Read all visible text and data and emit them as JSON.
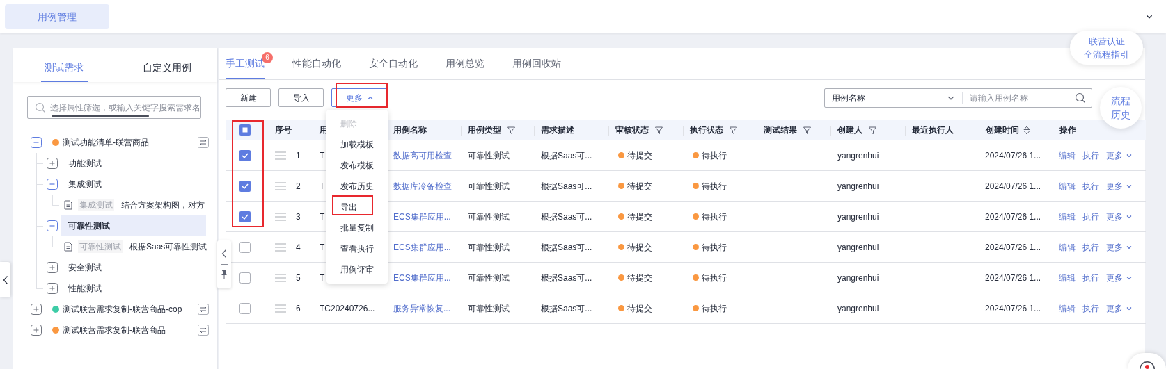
{
  "top_bar": {
    "tabs": [
      {
        "label": "用例管理",
        "selected": true
      }
    ]
  },
  "side_panel": {
    "tabs": [
      {
        "label": "测试需求",
        "selected": true
      },
      {
        "label": "自定义用例",
        "selected": false
      }
    ],
    "search": {
      "placeholder": "选择属性筛选，或输入关键字搜索需求名"
    },
    "tree": [
      {
        "kind": "group",
        "label": "测试功能清单-联营商品",
        "color": "#fa9841",
        "expanded": true,
        "selected": false,
        "children": [
          {
            "kind": "folder",
            "label": "功能测试",
            "expanded": false,
            "selected": false
          },
          {
            "kind": "folder",
            "label": "集成测试",
            "expanded": true,
            "selected": false,
            "children": [
              {
                "kind": "case",
                "tag": "集成测试",
                "label": "结合方案架构图，对方",
                "selected": false
              }
            ]
          },
          {
            "kind": "folder",
            "label": "可靠性测试",
            "expanded": true,
            "selected": true,
            "children": [
              {
                "kind": "case",
                "tag": "可靠性测试",
                "label": "根据Saas可靠性测试",
                "selected": false
              }
            ]
          },
          {
            "kind": "folder",
            "label": "安全测试",
            "expanded": false,
            "selected": false
          },
          {
            "kind": "folder",
            "label": "性能测试",
            "expanded": false,
            "selected": false
          }
        ]
      },
      {
        "kind": "group",
        "label": "测试联营需求复制-联营商品-cop",
        "color": "#3dcca6",
        "expanded": false,
        "selected": false
      },
      {
        "kind": "group",
        "label": "测试联营需求复制-联营商品",
        "color": "#fa9841",
        "expanded": false,
        "selected": false
      }
    ]
  },
  "main": {
    "tabs": [
      {
        "label": "手工测试",
        "selected": true,
        "badge": "6"
      },
      {
        "label": "性能自动化",
        "selected": false
      },
      {
        "label": "安全自动化",
        "selected": false
      },
      {
        "label": "用例总览",
        "selected": false
      },
      {
        "label": "用例回收站",
        "selected": false
      }
    ],
    "toolbar": [
      {
        "kind": "button",
        "label": "新建",
        "highlighted": false
      },
      {
        "kind": "button",
        "label": "导入",
        "highlighted": false
      },
      {
        "kind": "dropdown",
        "label": "更多",
        "expanded": true,
        "highlighted": true
      }
    ],
    "menu": [
      {
        "label": "删除",
        "disabled": true,
        "highlighted": false
      },
      {
        "label": "加载模板",
        "disabled": false,
        "highlighted": false
      },
      {
        "label": "发布模板",
        "disabled": false,
        "highlighted": false
      },
      {
        "label": "发布历史",
        "disabled": false,
        "highlighted": false
      },
      {
        "label": "导出",
        "disabled": false,
        "highlighted": true
      },
      {
        "label": "批量复制",
        "disabled": false,
        "highlighted": false
      },
      {
        "label": "查看执行",
        "disabled": false,
        "highlighted": false
      },
      {
        "label": "用例评审",
        "disabled": false,
        "highlighted": false
      }
    ],
    "search": {
      "field": "用例名称",
      "placeholder": "请输入用例名称"
    },
    "guide_button": [
      "联营认证",
      "全流程指引"
    ],
    "history_button": [
      "流程",
      "历史"
    ],
    "table": {
      "select_all": {
        "indeterminate": true
      },
      "checkbox_column_highlighted": true,
      "columns": [
        {
          "label": "序号"
        },
        {
          "label": "用"
        },
        {
          "label": "用例名称"
        },
        {
          "label": "用例类型",
          "filter": true
        },
        {
          "label": "需求描述"
        },
        {
          "label": "审核状态",
          "filter": true
        },
        {
          "label": "执行状态",
          "filter": true
        },
        {
          "label": "测试结果",
          "filter": true
        },
        {
          "label": "创建人",
          "filter": true
        },
        {
          "label": "最近执行人"
        },
        {
          "label": "创建时间",
          "sort": true
        },
        {
          "label": "操作"
        }
      ],
      "rows": [
        {
          "checked": true,
          "index": "1",
          "code": "T",
          "name": "数据高可用检查",
          "type": "可靠性测试",
          "description": "根据Saas可...",
          "review": {
            "text": "待提交",
            "color": "#fa9841"
          },
          "execution": {
            "text": "待执行",
            "color": "#fa9841"
          },
          "creator": "yangrenhui",
          "created": "2024/07/26 1...",
          "actions": [
            "编辑",
            "执行",
            "更多"
          ]
        },
        {
          "checked": true,
          "index": "2",
          "code": "T",
          "name": "数据库冷备检查",
          "type": "可靠性测试",
          "description": "根据Saas可...",
          "review": {
            "text": "待提交",
            "color": "#fa9841"
          },
          "execution": {
            "text": "待执行",
            "color": "#fa9841"
          },
          "creator": "yangrenhui",
          "created": "2024/07/26 1...",
          "actions": [
            "编辑",
            "执行",
            "更多"
          ]
        },
        {
          "checked": true,
          "index": "3",
          "code": "T",
          "name": "ECS集群应用...",
          "type": "可靠性测试",
          "description": "根据Saas可...",
          "review": {
            "text": "待提交",
            "color": "#fa9841"
          },
          "execution": {
            "text": "待执行",
            "color": "#fa9841"
          },
          "creator": "yangrenhui",
          "created": "2024/07/26 1...",
          "actions": [
            "编辑",
            "执行",
            "更多"
          ]
        },
        {
          "checked": false,
          "index": "4",
          "code": "T",
          "name": "ECS集群应用...",
          "type": "可靠性测试",
          "description": "根据Saas可...",
          "review": {
            "text": "待提交",
            "color": "#fa9841"
          },
          "execution": {
            "text": "待执行",
            "color": "#fa9841"
          },
          "creator": "yangrenhui",
          "created": "2024/07/26 1...",
          "actions": [
            "编辑",
            "执行",
            "更多"
          ]
        },
        {
          "checked": false,
          "index": "5",
          "code": "T",
          "name": "ECS集群应用...",
          "type": "可靠性测试",
          "description": "根据Saas可...",
          "review": {
            "text": "待提交",
            "color": "#fa9841"
          },
          "execution": {
            "text": "待执行",
            "color": "#fa9841"
          },
          "creator": "yangrenhui",
          "created": "2024/07/26 1...",
          "actions": [
            "编辑",
            "执行",
            "更多"
          ]
        },
        {
          "checked": false,
          "index": "6",
          "code": "TC20240726...",
          "name": "服务异常恢复...",
          "type": "可靠性测试",
          "description": "根据Saas可...",
          "review": {
            "text": "待提交",
            "color": "#fa9841"
          },
          "execution": {
            "text": "待执行",
            "color": "#fa9841"
          },
          "creator": "yangrenhui",
          "created": "2024/07/26 1...",
          "actions": [
            "编辑",
            "执行",
            "更多"
          ]
        }
      ]
    }
  }
}
